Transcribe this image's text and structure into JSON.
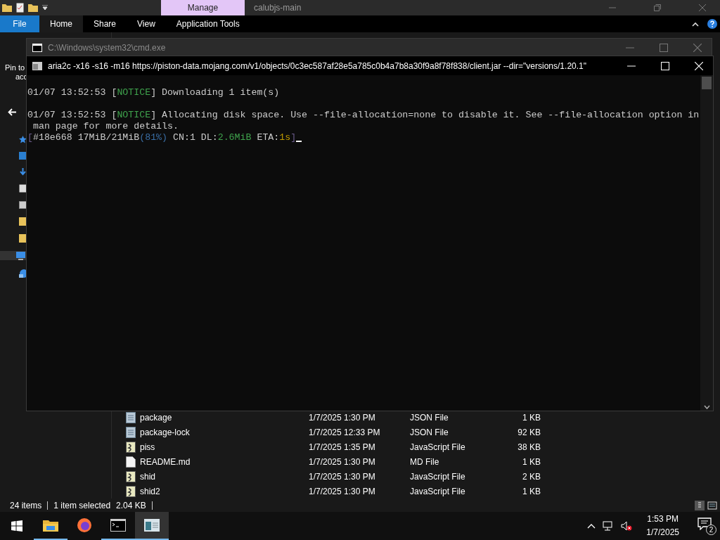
{
  "explorer": {
    "context_tab": "Manage",
    "title": "calubjs-main",
    "ribbon_tabs": [
      {
        "label": "File",
        "kind": "file",
        "selected": false
      },
      {
        "label": "Home",
        "kind": "tab",
        "selected": true
      },
      {
        "label": "Share",
        "kind": "tab",
        "selected": false
      },
      {
        "label": "View",
        "kind": "tab",
        "selected": false
      },
      {
        "label": "Application Tools",
        "kind": "tab",
        "selected": false
      }
    ],
    "ribbon_partial": [
      "Pin to",
      "acc"
    ],
    "files": [
      {
        "name": "package",
        "date": "1/7/2025 1:30 PM",
        "type": "JSON File",
        "size": "1 KB",
        "kind": "json"
      },
      {
        "name": "package-lock",
        "date": "1/7/2025 12:33 PM",
        "type": "JSON File",
        "size": "92 KB",
        "kind": "json"
      },
      {
        "name": "piss",
        "date": "1/7/2025 1:35 PM",
        "type": "JavaScript File",
        "size": "38 KB",
        "kind": "script"
      },
      {
        "name": "README.md",
        "date": "1/7/2025 1:30 PM",
        "type": "MD File",
        "size": "1 KB",
        "kind": "text"
      },
      {
        "name": "shid",
        "date": "1/7/2025 1:30 PM",
        "type": "JavaScript File",
        "size": "2 KB",
        "kind": "script"
      },
      {
        "name": "shid2",
        "date": "1/7/2025 1:30 PM",
        "type": "JavaScript File",
        "size": "1 KB",
        "kind": "script"
      }
    ],
    "status_bar": {
      "item_count": "24 items",
      "selection": "1 item selected",
      "selection_size": "2.04 KB"
    }
  },
  "windows": [
    {
      "active": false,
      "title": "C:\\Windows\\system32\\cmd.exe"
    },
    {
      "active": true,
      "title": "aria2c  -x16 -s16 -m16 https://piston-data.mojang.com/v1/objects/0c3ec587af28e5a785c0b4a7b8a30f9a8f78f838/client.jar --dir=\"versions/1.20.1\"",
      "lines": [
        {
          "kind": "text",
          "segments": [
            {
              "text": "01/07 13:52:53 [",
              "color": "#cccccc"
            },
            {
              "text": "NOTICE",
              "color": "#3fa34d"
            },
            {
              "text": "] Downloading 1 item(s)",
              "color": "#cccccc"
            }
          ]
        },
        {
          "kind": "blank"
        },
        {
          "kind": "text",
          "segments": [
            {
              "text": "01/07 13:52:53 [",
              "color": "#cccccc"
            },
            {
              "text": "NOTICE",
              "color": "#3fa34d"
            },
            {
              "text": "] Allocating disk space. Use --file-allocation=none to disable it. See --file-allocation option in",
              "color": "#cccccc"
            }
          ]
        },
        {
          "kind": "text",
          "segments": [
            {
              "text": " man page for more details.",
              "color": "#cccccc"
            }
          ]
        },
        {
          "kind": "text",
          "segments": [
            {
              "text": "[",
              "color": "#6a5a8a"
            },
            {
              "text": "#18e668 17MiB/21MiB",
              "color": "#cccccc"
            },
            {
              "text": "(81%)",
              "color": "#3a6ea5"
            },
            {
              "text": " CN:1 DL:",
              "color": "#cccccc"
            },
            {
              "text": "2.6MiB",
              "color": "#3fa34d"
            },
            {
              "text": " ETA:",
              "color": "#cccccc"
            },
            {
              "text": "1s",
              "color": "#c19c00"
            },
            {
              "text": "]",
              "color": "#6a5a8a"
            }
          ]
        }
      ]
    }
  ],
  "taskbar": {
    "apps": [
      {
        "kind": "folder",
        "running": true,
        "active": false
      },
      {
        "kind": "browser",
        "running": false,
        "active": false
      },
      {
        "kind": "terminal",
        "running": true,
        "active": false
      },
      {
        "kind": "app",
        "running": true,
        "active": true
      }
    ],
    "time": "1:53 PM",
    "date": "1/7/2025",
    "notification_count": "2"
  }
}
